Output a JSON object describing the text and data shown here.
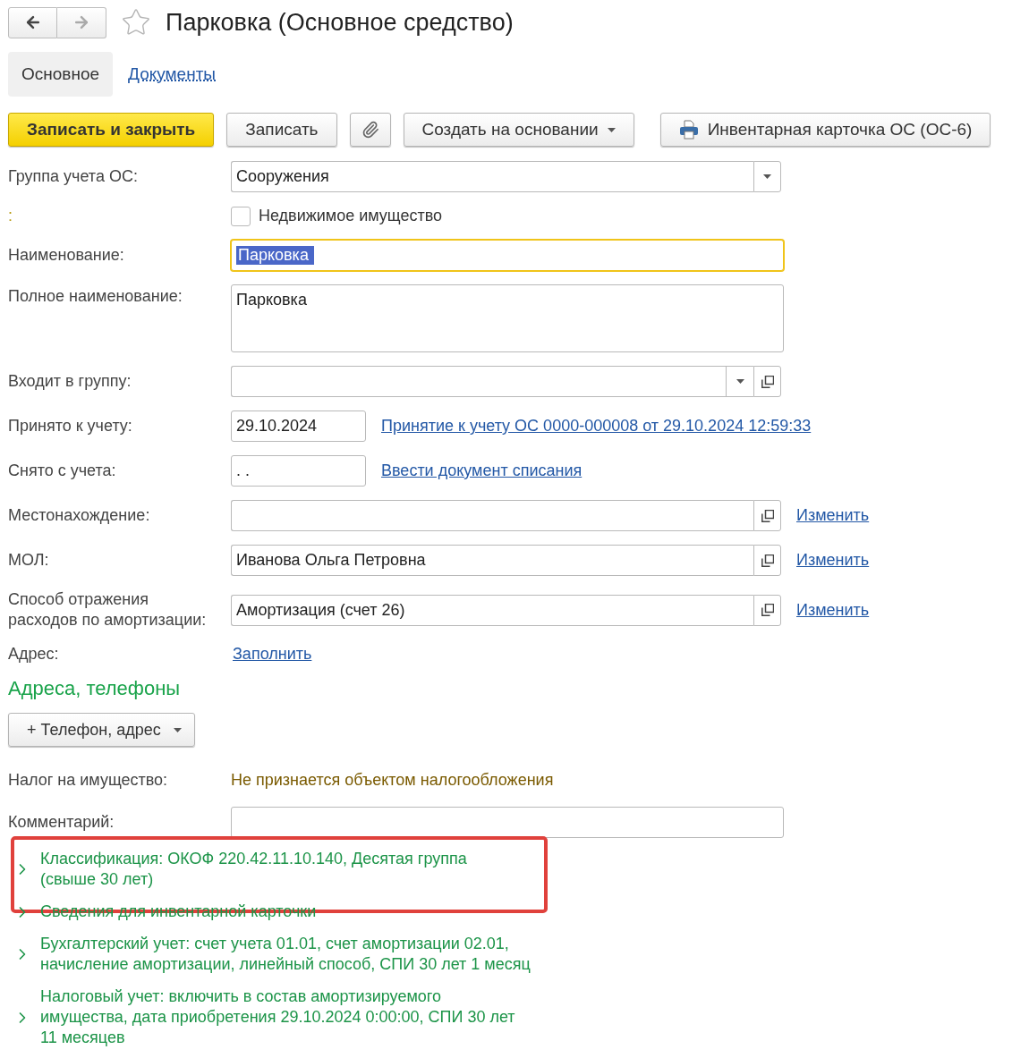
{
  "nav": {
    "back_enabled": true,
    "forward_enabled": false
  },
  "favorite": false,
  "title": "Парковка (Основное средство)",
  "tabs": [
    {
      "label": "Основное",
      "selected": true
    },
    {
      "label": "Документы",
      "selected": false
    }
  ],
  "toolbar": [
    {
      "kind": "primary",
      "label": "Записать и закрыть"
    },
    {
      "kind": "button",
      "label": "Записать"
    },
    {
      "kind": "attach"
    },
    {
      "kind": "menu",
      "label": "Создать на основании"
    },
    {
      "kind": "print",
      "label": "Инвентарная карточка ОС (ОС-6)"
    }
  ],
  "fields": [
    {
      "kind": "select",
      "label": "Группа учета ОС:",
      "value": "Сооружения"
    },
    {
      "kind": "checkbox",
      "label": ":",
      "text": "Недвижимое имущество",
      "checked": false
    },
    {
      "kind": "input",
      "label": "Наименование:",
      "value": "Парковка",
      "focused": true
    },
    {
      "kind": "textarea",
      "label": "Полное наименование:",
      "value": "Парковка"
    },
    {
      "kind": "select_open",
      "label": "Входит в группу:"
    },
    {
      "kind": "date",
      "label": "Принято к учету:",
      "value": "29.10.2024",
      "link": "Принятие к учету ОС 0000-000008 от 29.10.2024 12:59:33"
    },
    {
      "kind": "date",
      "label": "Снято с учета:",
      "value": ". .",
      "link": "Ввести документ списания"
    },
    {
      "kind": "ref",
      "label": "Местонахождение:",
      "link": "Изменить"
    },
    {
      "kind": "ref",
      "label": "МОЛ:",
      "value": "Иванова Ольга Петровна",
      "link": "Изменить"
    },
    {
      "kind": "ref",
      "label": "Способ отражения расходов по амортизации:",
      "value": "Амортизация (счет 26)",
      "link": "Изменить"
    },
    {
      "kind": "link",
      "label": "Адрес:",
      "link": "Заполнить"
    }
  ],
  "contacts": {
    "title": "Адреса, телефоны",
    "button": "+ Телефон, адрес"
  },
  "fields_2": [
    {
      "kind": "note",
      "label": "Налог на имущество:",
      "value": "Не признается объектом налогообложения"
    },
    {
      "kind": "input",
      "label": "Комментарий:",
      "focused": false
    }
  ],
  "groups": [
    {
      "lines": [
        "Классификация: ОКОФ 220.42.11.10.140, Десятая группа",
        "(свыше 30 лет)"
      ],
      "expanded": false,
      "highlighted": true
    },
    {
      "lines": [
        "Сведения для инвентарной карточки"
      ],
      "expanded": false,
      "highlighted": false
    },
    {
      "lines": [
        "Бухгалтерский учет: счет учета 01.01, счет амортизации 02.01,",
        "начисление амортизации, линейный способ, СПИ 30 лет 1 месяц"
      ],
      "expanded": false,
      "highlighted": false
    },
    {
      "lines": [
        "Налоговый учет: включить в состав амортизируемого",
        "имущества, дата приобретения 29.10.2024 0:00:00, СПИ 30 лет",
        "11 месяцев"
      ],
      "expanded": false,
      "highlighted": false
    }
  ]
}
